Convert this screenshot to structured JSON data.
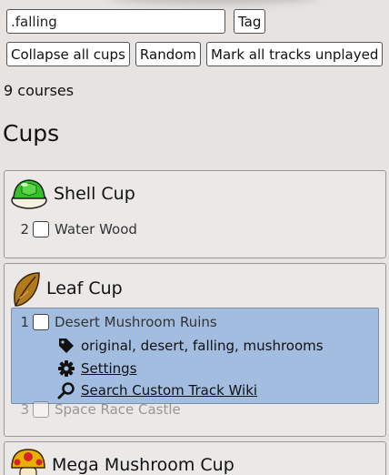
{
  "search": {
    "value": ".falling"
  },
  "toolbar": {
    "tag_label": "Tag",
    "collapse_label": "Collapse all cups",
    "random_label": "Random",
    "mark_unplayed_label": "Mark all tracks unplayed"
  },
  "course_count": "9 courses",
  "cups_heading": "Cups",
  "cups": [
    {
      "name": "Shell Cup",
      "icon": "green-shell-icon",
      "tracks": [
        {
          "number": "2",
          "name": "Water Wood",
          "checked": false
        }
      ]
    },
    {
      "name": "Leaf Cup",
      "icon": "leaf-icon",
      "tracks": [
        {
          "number": "1",
          "name": "Desert Mushroom Ruins",
          "checked": false
        },
        {
          "number": "3",
          "name": "Space Race Castle",
          "checked": false
        }
      ],
      "expanded_track": {
        "tags": "original, desert, falling, mushrooms",
        "settings_label": "Settings",
        "wiki_label": "Search Custom Track Wiki"
      }
    },
    {
      "name": "Mega Mushroom Cup",
      "icon": "mega-mushroom-icon",
      "tracks": []
    }
  ],
  "colors": {
    "background": "#e6e3e0",
    "selection": "#a2bde0"
  }
}
